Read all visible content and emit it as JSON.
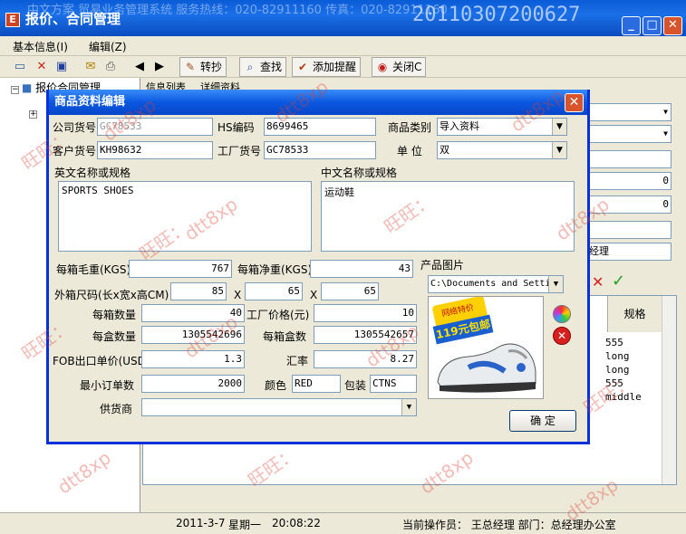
{
  "window": {
    "title": "报价、合同管理",
    "title_background": "中文方案  贸易业务管理系统   服务热线：020-82911160  传真：020-82911160",
    "stamp": "20110307200627",
    "menus": [
      "基本信息(I)",
      "编辑(Z)"
    ],
    "controls": {
      "min": "_",
      "max": "□",
      "close": "✕"
    }
  },
  "toolbar": {
    "buttons": [
      {
        "label": "转抄",
        "icon": "copy-icon"
      },
      {
        "label": "查找",
        "icon": "search-icon"
      },
      {
        "label": "添加提醒",
        "icon": "reminder-icon"
      },
      {
        "label": "关闭C",
        "icon": "close-icon"
      }
    ]
  },
  "tree": {
    "root": "报价合同管理"
  },
  "right_panel": {
    "tabs": [
      "信息列表",
      "详细资料"
    ],
    "values": [
      "0",
      "0",
      "经理"
    ],
    "grid": {
      "header": "规格",
      "rows": [
        "555",
        "long",
        "long",
        "555",
        "middle"
      ]
    }
  },
  "statusbar": {
    "date": "2011-3-7",
    "weekday": "星期一",
    "time": "20:08:22",
    "operator": "当前操作员：  王总经理   部门：总经理办公室"
  },
  "dialog": {
    "title": "商品资料编辑",
    "labels": {
      "company_code": "公司货号",
      "hs_code": "HS编码",
      "category": "商品类别",
      "customer_code": "客户货号",
      "factory_code": "工厂货号",
      "unit": "单  位",
      "en_name": "英文名称或规格",
      "cn_name": "中文名称或规格",
      "gross_weight": "每箱毛重(KGS)",
      "net_weight": "每箱净重(KGS)",
      "dimensions": "外箱尺码(长x宽x高CM)",
      "per_box": "每箱数量",
      "factory_price": "工厂价格(元)",
      "per_pack": "每盒数量",
      "packs_per_box": "每箱盒数",
      "fob_price": "FOB出口单价(USD)",
      "exchange_rate": "汇率",
      "min_order": "最小订单数",
      "color": "颜色",
      "packing": "包装",
      "supplier": "供货商",
      "photo": "产品图片",
      "x": "X"
    },
    "values": {
      "company_code": "GC78533",
      "hs_code": "8699465",
      "category": "导入资料",
      "customer_code": "KH98632",
      "factory_code": "GC78533",
      "unit": "双",
      "en_name": "SPORTS SHOES",
      "cn_name": "运动鞋",
      "gross_weight": "767",
      "net_weight": "43",
      "dim_l": "85",
      "dim_w": "65",
      "dim_h": "65",
      "per_box": "40",
      "factory_price": "10",
      "per_pack": "1305542696",
      "packs_per_box": "1305542657",
      "fob_price": "1.3",
      "exchange_rate": "8.27",
      "min_order": "2000",
      "color": "RED",
      "packing": "CTNS",
      "supplier": "",
      "photo_path": "C:\\Documents and Settings"
    },
    "photo_text": {
      "top": "网络特价",
      "price": "119元包邮"
    },
    "confirm": "确  定"
  },
  "watermarks": [
    "旺旺：",
    "dtt8xp"
  ]
}
